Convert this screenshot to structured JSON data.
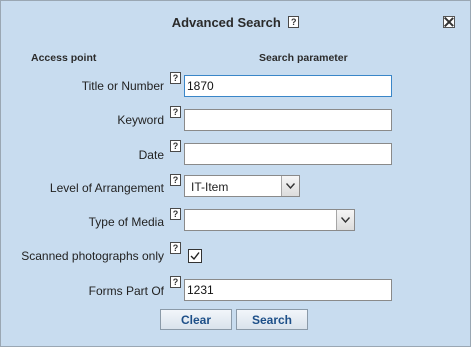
{
  "dialog": {
    "title": "Advanced Search",
    "help_glyph": "?",
    "close_icon": "close-icon"
  },
  "columns": {
    "access_point": "Access point",
    "search_parameter": "Search parameter"
  },
  "fields": {
    "title_or_number": {
      "label": "Title or Number",
      "value": "1870"
    },
    "keyword": {
      "label": "Keyword",
      "value": ""
    },
    "date": {
      "label": "Date",
      "value": ""
    },
    "level_of_arrangement": {
      "label": "Level of Arrangement",
      "selected": "IT-Item"
    },
    "type_of_media": {
      "label": "Type of Media",
      "selected": ""
    },
    "scanned_photographs_only": {
      "label": "Scanned photographs only",
      "checked": true
    },
    "forms_part_of": {
      "label": "Forms Part Of",
      "value": "1231"
    }
  },
  "buttons": {
    "clear": "Clear",
    "search": "Search"
  },
  "colors": {
    "dialog_background": "#c8dcef",
    "button_text": "#1d4f88",
    "focus_border": "#3a86c8"
  }
}
